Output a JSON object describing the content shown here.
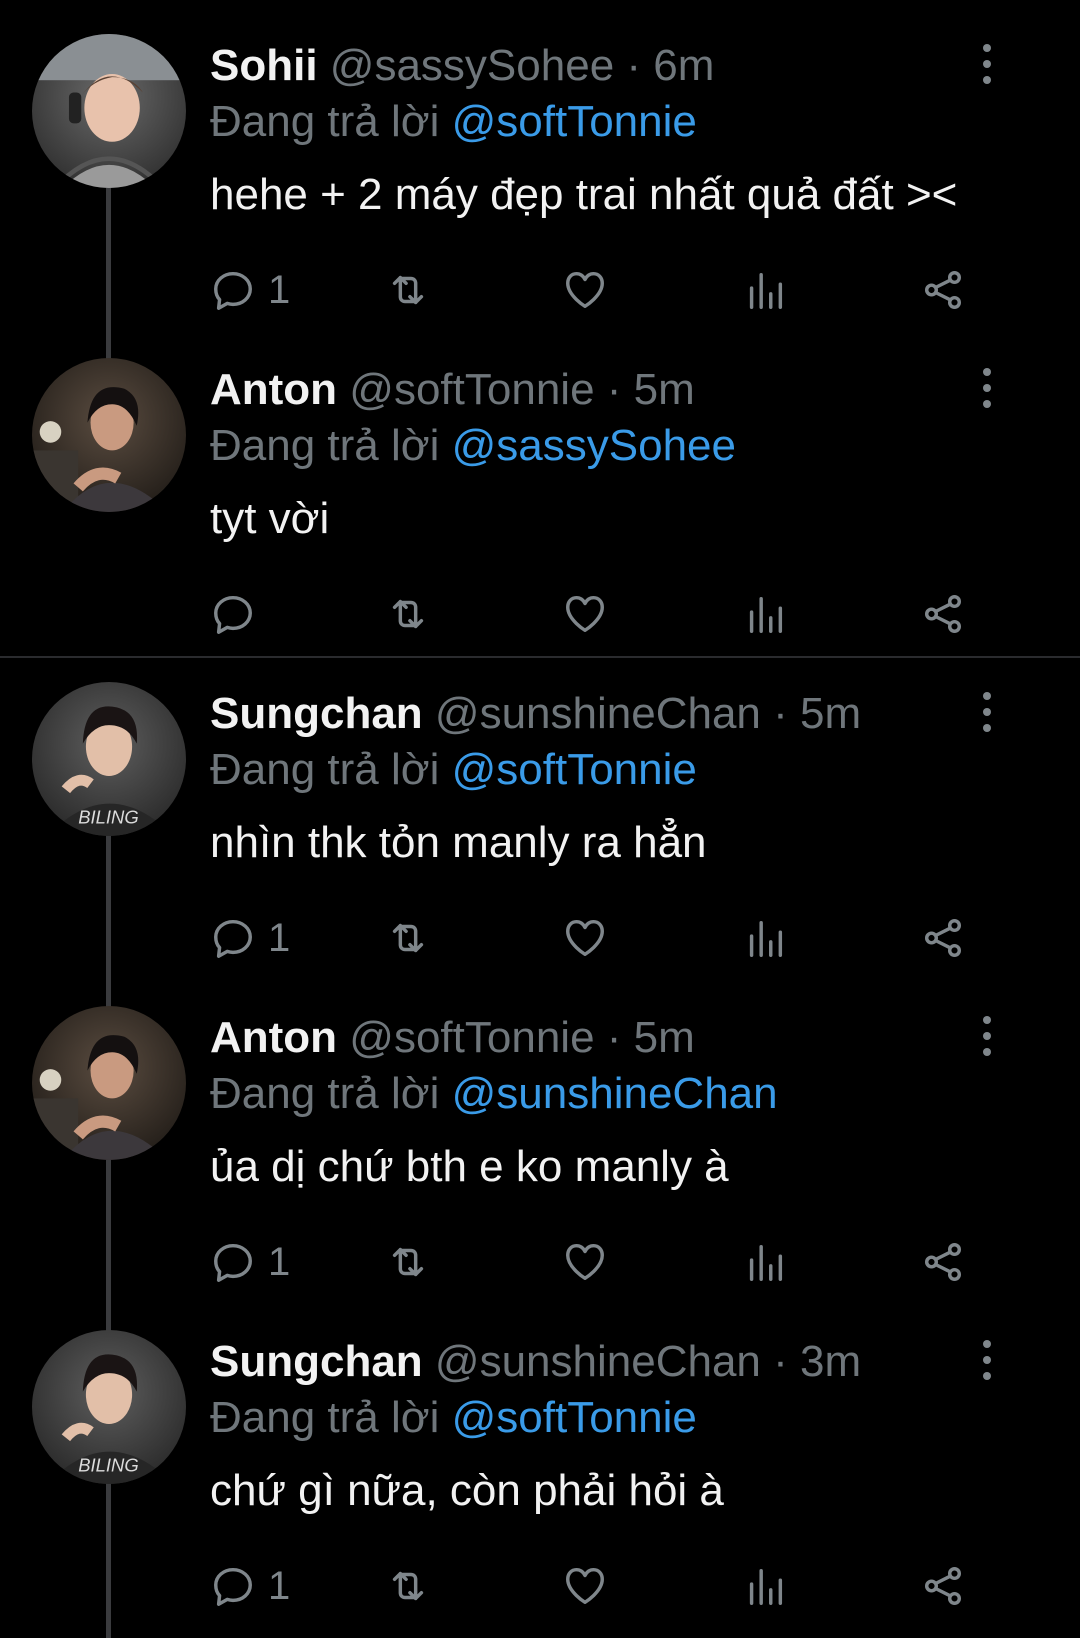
{
  "tweets": [
    {
      "name": "Sohii",
      "handle": "@sassySohee",
      "time": "6m",
      "reply_prefix": "Đang trả lời",
      "reply_to": "@softTonnie",
      "text": "hehe + 2 máy đẹp trai nhất quả đất ><",
      "reply_count": "1",
      "avatar": "avatar-sohii"
    },
    {
      "name": "Anton",
      "handle": "@softTonnie",
      "time": "5m",
      "reply_prefix": "Đang trả lời",
      "reply_to": "@sassySohee",
      "text": "tyt vời",
      "reply_count": "",
      "avatar": "avatar-anton"
    },
    {
      "name": "Sungchan",
      "handle": "@sunshineChan",
      "time": "5m",
      "reply_prefix": "Đang trả lời",
      "reply_to": "@softTonnie",
      "text": "nhìn thk tỏn manly ra hẳn",
      "reply_count": "1",
      "avatar": "avatar-sungchan"
    },
    {
      "name": "Anton",
      "handle": "@softTonnie",
      "time": "5m",
      "reply_prefix": "Đang trả lời",
      "reply_to": "@sunshineChan",
      "text": "ủa dị chứ bth e ko manly à",
      "reply_count": "1",
      "avatar": "avatar-anton"
    },
    {
      "name": "Sungchan",
      "handle": "@sunshineChan",
      "time": "3m",
      "reply_prefix": "Đang trả lời",
      "reply_to": "@softTonnie",
      "text": "chứ gì nữa, còn phải hỏi à",
      "reply_count": "1",
      "avatar": "avatar-sungchan"
    }
  ],
  "separator": "·",
  "icons": [
    "reply-icon",
    "retweet-icon",
    "like-icon",
    "views-icon",
    "share-icon",
    "more-icon"
  ],
  "colors": {
    "background": "#000000",
    "mention": "#3a9be8",
    "muted": "#6f767b"
  }
}
